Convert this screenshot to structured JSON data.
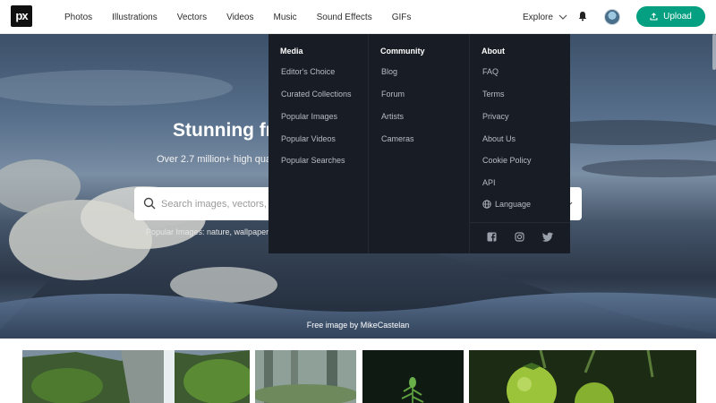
{
  "header": {
    "logo_text": "px",
    "nav": [
      "Photos",
      "Illustrations",
      "Vectors",
      "Videos",
      "Music",
      "Sound Effects",
      "GIFs"
    ],
    "explore_label": "Explore",
    "upload_label": "Upload"
  },
  "hero": {
    "title": "Stunning fr",
    "subtitle": "Over 2.7 million+ high qual",
    "search_placeholder": "Search images, vectors, v",
    "popular_text": "Popular Images: nature, wallpaper",
    "credit": "Free image by MikeCastelan"
  },
  "dropdown": {
    "media": {
      "title": "Media",
      "items": [
        "Editor's Choice",
        "Curated Collections",
        "Popular Images",
        "Popular Videos",
        "Popular Searches"
      ]
    },
    "community": {
      "title": "Community",
      "items": [
        "Blog",
        "Forum",
        "Artists",
        "Cameras"
      ]
    },
    "about": {
      "title": "About",
      "items": [
        "FAQ",
        "Terms",
        "Privacy",
        "About Us",
        "Cookie Policy",
        "API"
      ],
      "language_label": "Language"
    }
  },
  "colors": {
    "brand_green": "#05a081",
    "dropdown_bg": "#181c24"
  }
}
